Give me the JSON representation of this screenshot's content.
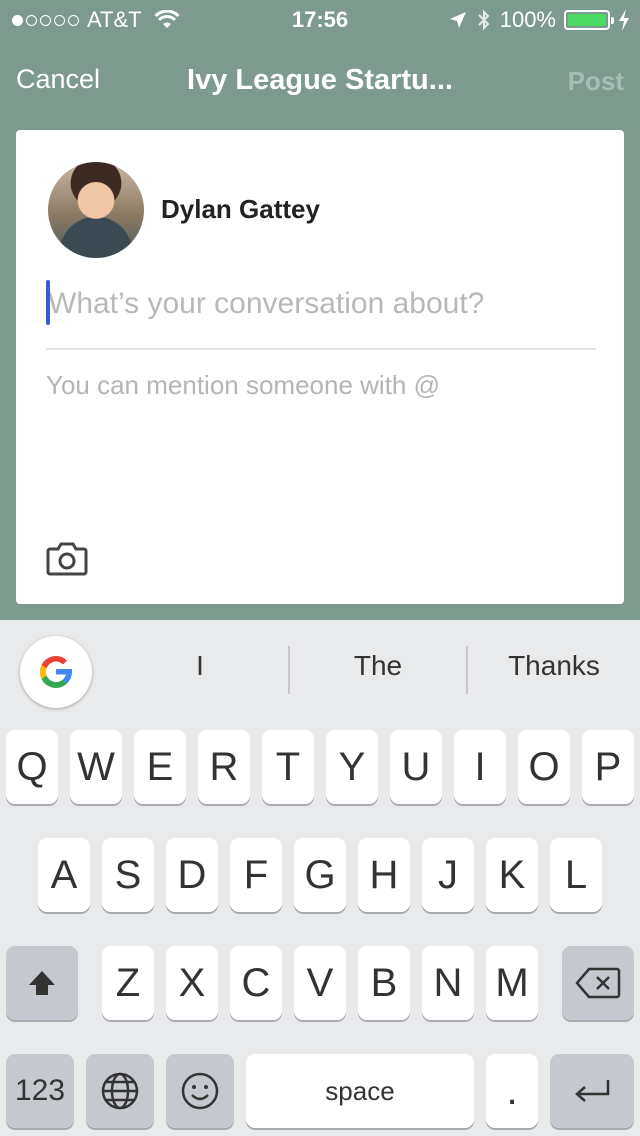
{
  "status_bar": {
    "carrier": "AT&T",
    "time": "17:56",
    "battery": "100%",
    "signal_bars_filled": 1,
    "signal_bars_total": 5
  },
  "nav": {
    "cancel_label": "Cancel",
    "title": "Ivy League Startu...",
    "post_label": "Post"
  },
  "compose": {
    "author_name": "Dylan Gattey",
    "subject_placeholder": "What’s your conversation about?",
    "body_placeholder": "You can mention someone with @"
  },
  "keyboard": {
    "suggestions": [
      "I",
      "The",
      "Thanks"
    ],
    "row1": [
      "Q",
      "W",
      "E",
      "R",
      "T",
      "Y",
      "U",
      "I",
      "O",
      "P"
    ],
    "row2": [
      "A",
      "S",
      "D",
      "F",
      "G",
      "H",
      "J",
      "K",
      "L"
    ],
    "row3": [
      "Z",
      "X",
      "C",
      "V",
      "B",
      "N",
      "M"
    ],
    "numbers_label": "123",
    "space_label": "space",
    "period_label": "."
  },
  "colors": {
    "header_bg": "#7e9a8f",
    "cursor": "#3a5ccc",
    "battery": "#4cd964"
  }
}
